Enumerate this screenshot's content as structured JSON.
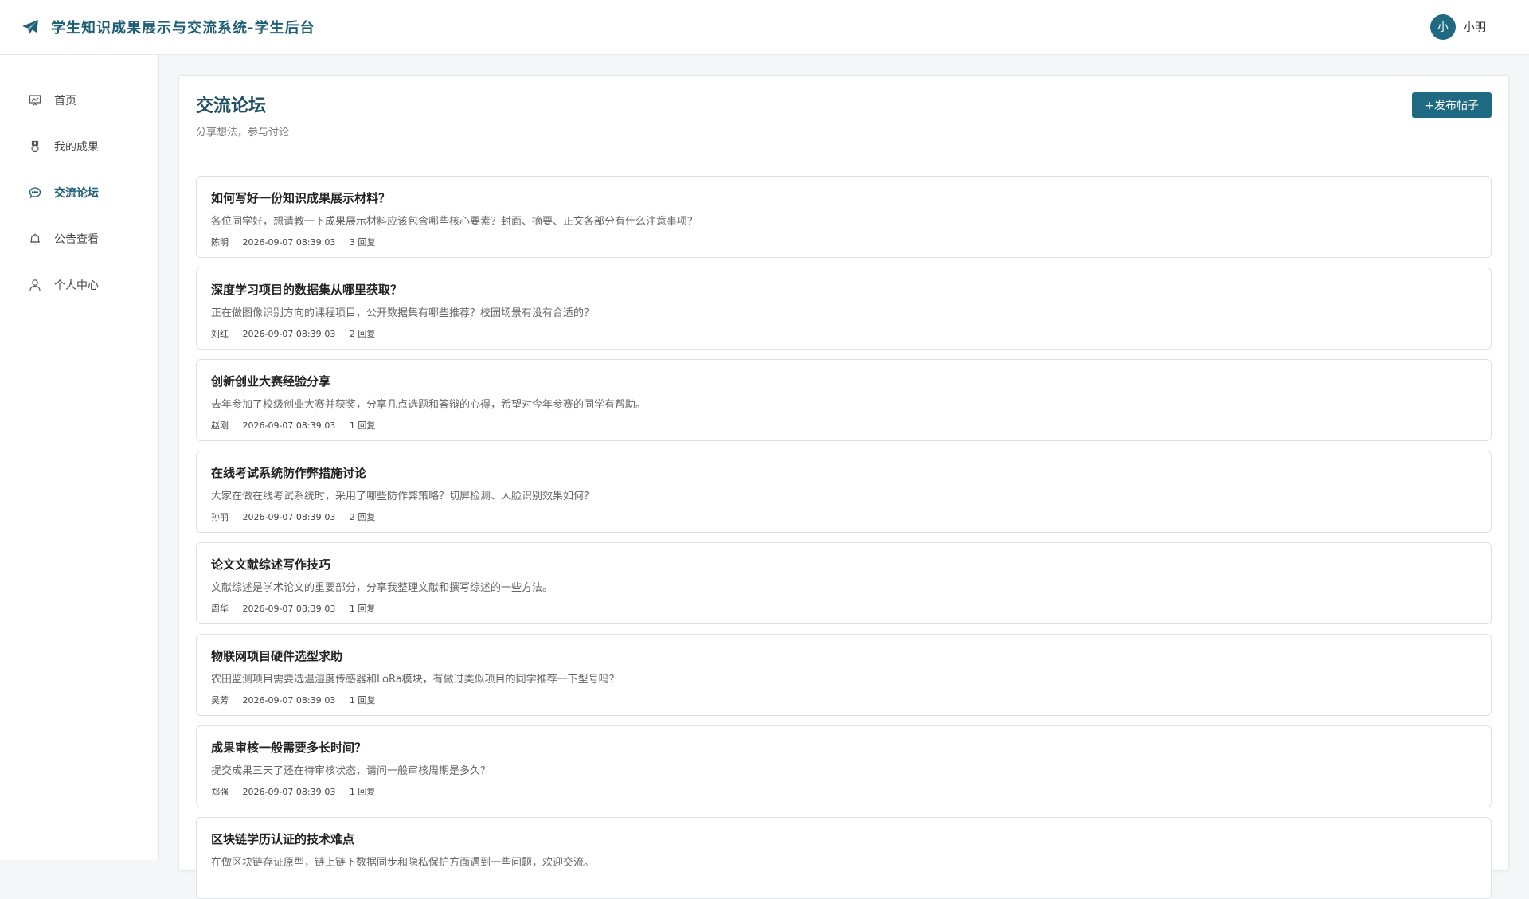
{
  "app": {
    "title": "学生知识成果展示与交流系统-学生后台"
  },
  "user": {
    "avatar_text": "小",
    "name": "小明"
  },
  "sidebar": {
    "items": [
      {
        "label": "首页",
        "icon": "presentation-icon",
        "active": false
      },
      {
        "label": "我的成果",
        "icon": "medal-icon",
        "active": false
      },
      {
        "label": "交流论坛",
        "icon": "chat-icon",
        "active": true
      },
      {
        "label": "公告查看",
        "icon": "bell-icon",
        "active": false
      },
      {
        "label": "个人中心",
        "icon": "user-icon",
        "active": false
      }
    ]
  },
  "page": {
    "title": "交流论坛",
    "subtitle": "分享想法，参与讨论",
    "publish_button": "+发布帖子"
  },
  "posts": [
    {
      "title": "如何写好一份知识成果展示材料？",
      "excerpt": "各位同学好，想请教一下成果展示材料应该包含哪些核心要素？封面、摘要、正文各部分有什么注意事项？",
      "author": "陈明",
      "time": "2026-09-07 08:39:03",
      "replies": "3 回复"
    },
    {
      "title": "深度学习项目的数据集从哪里获取？",
      "excerpt": "正在做图像识别方向的课程项目，公开数据集有哪些推荐？校园场景有没有合适的？",
      "author": "刘红",
      "time": "2026-09-07 08:39:03",
      "replies": "2 回复"
    },
    {
      "title": "创新创业大赛经验分享",
      "excerpt": "去年参加了校级创业大赛并获奖，分享几点选题和答辩的心得，希望对今年参赛的同学有帮助。",
      "author": "赵刚",
      "time": "2026-09-07 08:39:03",
      "replies": "1 回复"
    },
    {
      "title": "在线考试系统防作弊措施讨论",
      "excerpt": "大家在做在线考试系统时，采用了哪些防作弊策略？切屏检测、人脸识别效果如何？",
      "author": "孙丽",
      "time": "2026-09-07 08:39:03",
      "replies": "2 回复"
    },
    {
      "title": "论文文献综述写作技巧",
      "excerpt": "文献综述是学术论文的重要部分，分享我整理文献和撰写综述的一些方法。",
      "author": "周华",
      "time": "2026-09-07 08:39:03",
      "replies": "1 回复"
    },
    {
      "title": "物联网项目硬件选型求助",
      "excerpt": "农田监测项目需要选温湿度传感器和LoRa模块，有做过类似项目的同学推荐一下型号吗？",
      "author": "吴芳",
      "time": "2026-09-07 08:39:03",
      "replies": "1 回复"
    },
    {
      "title": "成果审核一般需要多长时间？",
      "excerpt": "提交成果三天了还在待审核状态，请问一般审核周期是多久？",
      "author": "郑强",
      "time": "2026-09-07 08:39:03",
      "replies": "1 回复"
    },
    {
      "title": "区块链学历认证的技术难点",
      "excerpt": "在做区块链存证原型，链上链下数据同步和隐私保护方面遇到一些问题，欢迎交流。",
      "author": "",
      "time": "",
      "replies": ""
    }
  ],
  "colors": {
    "accent": "#1f6a82",
    "title": "#1f5f75"
  }
}
